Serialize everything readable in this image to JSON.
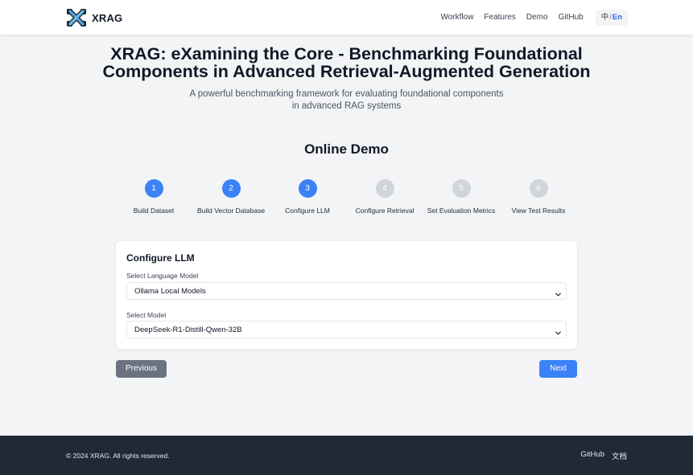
{
  "header": {
    "brand": "XRAG",
    "nav": [
      {
        "label": "Workflow"
      },
      {
        "label": "Features"
      },
      {
        "label": "Demo"
      },
      {
        "label": "GitHub"
      }
    ],
    "lang": {
      "zh": "中",
      "sep": "/",
      "en": "En",
      "active": "En"
    }
  },
  "hero": {
    "title_line1": "XRAG: eXamining the Core - Benchmarking Foundational",
    "title_line2": "Components in Advanced Retrieval-Augmented Generation",
    "subtitle_line1": "A powerful benchmarking framework for evaluating foundational components",
    "subtitle_line2": "in advanced RAG systems"
  },
  "demo": {
    "title": "Online Demo",
    "current_step": 3,
    "steps": [
      {
        "number": "1",
        "label": "Build Dataset",
        "state": "done"
      },
      {
        "number": "2",
        "label": "Build Vector Database",
        "state": "done"
      },
      {
        "number": "3",
        "label": "Configure LLM",
        "state": "active"
      },
      {
        "number": "4",
        "label": "Configure Retrieval",
        "state": "pending"
      },
      {
        "number": "5",
        "label": "Set Evaluation Metrics",
        "state": "pending"
      },
      {
        "number": "6",
        "label": "View Test Results",
        "state": "pending"
      }
    ],
    "card": {
      "title": "Configure LLM",
      "language_model": {
        "label": "Select Language Model",
        "value": "Ollama Local Models"
      },
      "model": {
        "label": "Select Model",
        "value": "DeepSeek-R1-Distill-Qwen-32B"
      }
    },
    "prev_label": "Previous",
    "next_label": "Next"
  },
  "footer": {
    "copyright": "© 2024 XRAG. All rights reserved.",
    "links": [
      {
        "label": "GitHub"
      },
      {
        "label": "文档"
      }
    ]
  },
  "colors": {
    "primary": "#3b82f6",
    "inactive_step": "#d1d5db",
    "secondary_button": "#6b7280",
    "footer_bg": "#1f2937",
    "page_bg": "#f3f4f6",
    "lang_active": "#2563eb"
  },
  "icons": {
    "logo": "xrag-logo-icon",
    "select_caret": "chevron-down-icon"
  }
}
